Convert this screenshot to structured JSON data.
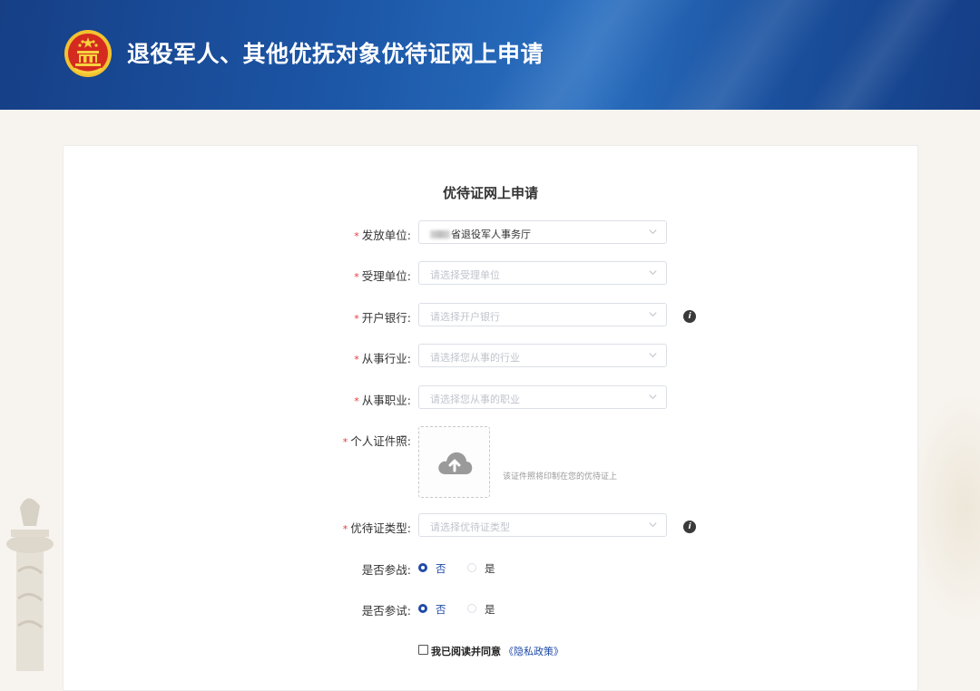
{
  "header": {
    "title": "退役军人、其他优抚对象优待证网上申请"
  },
  "form": {
    "title": "优待证网上申请",
    "fields": [
      {
        "label": "发放单位:",
        "value": "省退役军人事务厅",
        "placeholder": "",
        "required": true
      },
      {
        "label": "受理单位:",
        "value": "",
        "placeholder": "请选择受理单位",
        "required": true
      },
      {
        "label": "开户银行:",
        "value": "",
        "placeholder": "请选择开户银行",
        "required": true
      },
      {
        "label": "从事行业:",
        "value": "",
        "placeholder": "请选择您从事的行业",
        "required": true
      },
      {
        "label": "从事职业:",
        "value": "",
        "placeholder": "请选择您从事的职业",
        "required": true
      }
    ],
    "photo": {
      "label": "个人证件照:",
      "hint": "该证件照将印制在您的优待证上",
      "required": true
    },
    "card_type": {
      "label": "优待证类型:",
      "placeholder": "请选择优待证类型",
      "required": true
    },
    "combat": {
      "label": "是否参战:",
      "options": [
        "否",
        "是"
      ],
      "selected": "否"
    },
    "nuclear_test": {
      "label": "是否参试:",
      "options": [
        "否",
        "是"
      ],
      "selected": "否"
    },
    "agreement": {
      "text": "我已阅读并同意",
      "link": "《隐私政策》",
      "checked": false
    }
  },
  "colors": {
    "primary": "#1f4aa8",
    "required_star": "#e4393c",
    "header_bg": "#1c56a6"
  },
  "icons": {
    "select_arrow": "chevron-down-icon",
    "info": "info-icon",
    "upload": "cloud-upload-icon"
  }
}
